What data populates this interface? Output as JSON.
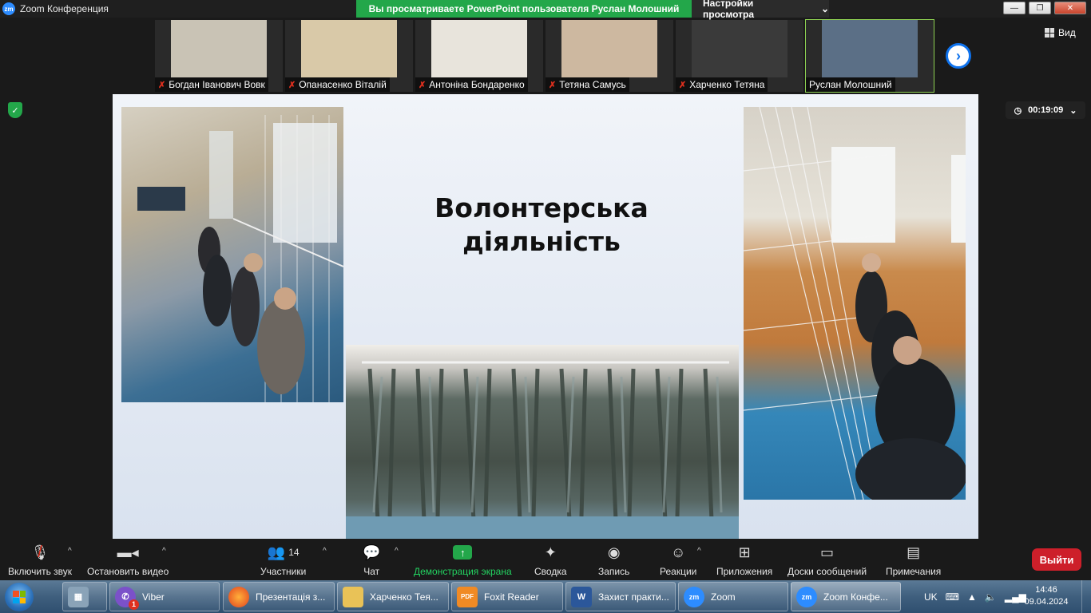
{
  "window": {
    "title": "Zoom Конференция",
    "logo_text": "zm",
    "share_banner": "Вы просматриваете PowerPoint пользователя Руслан Молошний",
    "view_settings": "Настройки просмотра",
    "controls": [
      "minimize-icon",
      "maximize-icon",
      "close-icon"
    ]
  },
  "participants": [
    {
      "name": "Богдан Іванович Вовк",
      "muted": true,
      "bg": "#c9c3b5"
    },
    {
      "name": "Опанасенко Віталій",
      "muted": true,
      "bg": "#d9c9a8"
    },
    {
      "name": "Антоніна Бондаренко",
      "muted": true,
      "bg": "#e8e4dc"
    },
    {
      "name": "Тетяна Самусь",
      "muted": true,
      "bg": "#cdb8a0"
    },
    {
      "name": "Харченко Тетяна",
      "muted": true,
      "bg": "#3a3a3a"
    },
    {
      "name": "Руслан Молошний",
      "muted": false,
      "bg": "#5b6f86"
    }
  ],
  "strip": {
    "next_icon": "chevron-right-icon",
    "view_label": "Вид"
  },
  "meeting": {
    "timer": "00:19:09",
    "security_icon": "shield-check-icon"
  },
  "slide": {
    "title_line1": "Волонтерська",
    "title_line2": "діяльність",
    "photos": [
      "students-weaving-net-photo",
      "camouflage-net-photo",
      "students-at-gym-net-photo"
    ]
  },
  "toolbar": {
    "audio": {
      "label": "Включить звук",
      "icon": "mic-off-icon"
    },
    "video": {
      "label": "Остановить видео",
      "icon": "video-camera-icon"
    },
    "participants": {
      "label": "Участники",
      "count": "14",
      "icon": "people-icon"
    },
    "chat": {
      "label": "Чат",
      "icon": "chat-bubble-icon"
    },
    "share": {
      "label": "Демонстрация экрана",
      "icon": "share-screen-icon",
      "color": "#23a74a"
    },
    "summary": {
      "label": "Сводка",
      "icon": "summary-icon"
    },
    "record": {
      "label": "Запись",
      "icon": "record-icon"
    },
    "reactions": {
      "label": "Реакции",
      "icon": "emoji-icon"
    },
    "apps": {
      "label": "Приложения",
      "icon": "apps-icon"
    },
    "whiteboards": {
      "label": "Доски сообщений",
      "icon": "whiteboard-icon"
    },
    "notes": {
      "label": "Примечания",
      "icon": "notes-icon"
    },
    "leave": {
      "label": "Выйти",
      "color": "#cd1f2a"
    }
  },
  "taskbar": {
    "apps": [
      {
        "label": "",
        "icon": "calculator-icon"
      },
      {
        "label": "Viber",
        "icon": "viber-icon",
        "badge": "1"
      },
      {
        "label": "Презентація з...",
        "icon": "firefox-icon"
      },
      {
        "label": "Харченко Тея...",
        "icon": "folder-icon"
      },
      {
        "label": "Foxit Reader",
        "icon": "foxit-pdf-icon"
      },
      {
        "label": "Захист практи...",
        "icon": "word-icon"
      },
      {
        "label": "Zoom",
        "icon": "zoom-icon"
      },
      {
        "label": "Zoom Конфе...",
        "icon": "zoom-icon"
      }
    ],
    "lang": "UK",
    "time": "14:46",
    "date": "09.04.2024"
  }
}
